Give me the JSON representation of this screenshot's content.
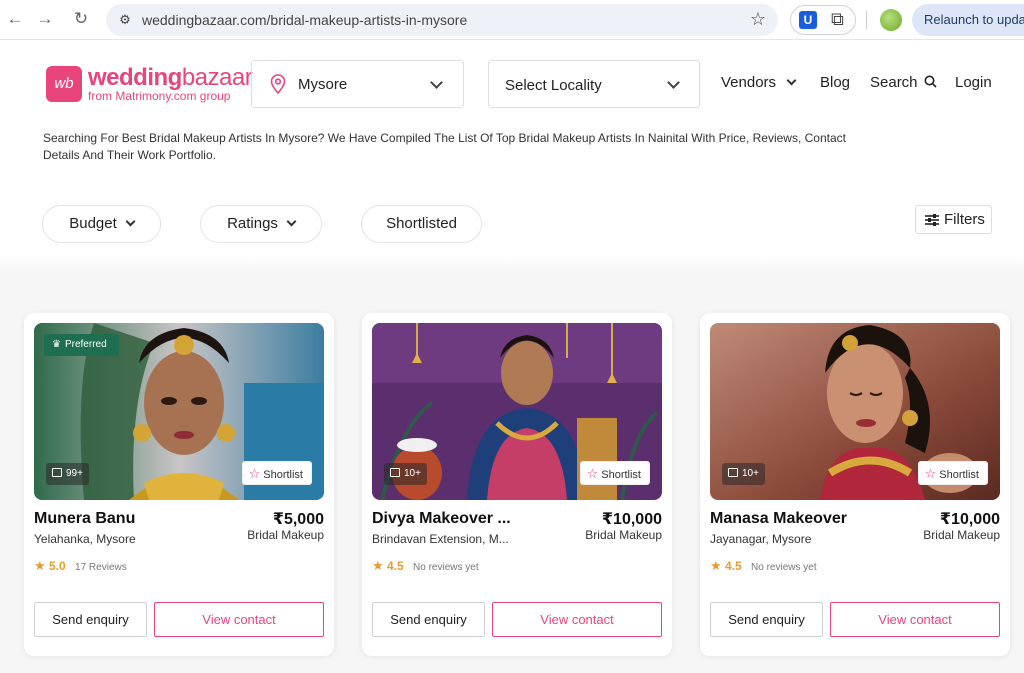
{
  "browser": {
    "url": "weddingbazaar.com/bridal-makeup-artists-in-mysore",
    "relaunch_label": "Relaunch to update"
  },
  "site": {
    "logo_word_1": "wedding",
    "logo_word_2": "bazaar",
    "logo_mark": "wb",
    "logo_sub": "from Matrimony.com group",
    "city": "Mysore",
    "locality_placeholder": "Select Locality",
    "nav": {
      "vendors": "Vendors",
      "blog": "Blog",
      "search": "Search",
      "login": "Login"
    },
    "intro": "Searching For Best Bridal Makeup Artists In Mysore? We Have Compiled The List Of Top Bridal Makeup Artists In Nainital With Price, Reviews, Contact Details And Their Work Portfolio."
  },
  "filters": {
    "budget": "Budget",
    "ratings": "Ratings",
    "shortlisted": "Shortlisted",
    "filters_button": "Filters"
  },
  "colors": {
    "brand_pink": "#e8457d",
    "preferred_green": "#1f6e52",
    "rating_orange": "#e89b2a"
  },
  "cards": [
    {
      "name": "Munera Banu",
      "location": "Yelahanka, Mysore",
      "price": "₹5,000",
      "category": "Bridal Makeup",
      "rating": "5.0",
      "reviews": "17 Reviews",
      "photo_count": "99+",
      "preferred": "Preferred",
      "shortlist": "Shortlist",
      "enquiry": "Send enquiry",
      "contact": "View contact"
    },
    {
      "name": "Divya Makeover ...",
      "location": "Brindavan Extension, M...",
      "price": "₹10,000",
      "category": "Bridal Makeup",
      "rating": "4.5",
      "reviews": "No reviews yet",
      "photo_count": "10+",
      "shortlist": "Shortlist",
      "enquiry": "Send enquiry",
      "contact": "View contact"
    },
    {
      "name": "Manasa Makeover",
      "location": "Jayanagar, Mysore",
      "price": "₹10,000",
      "category": "Bridal Makeup",
      "rating": "4.5",
      "reviews": "No reviews yet",
      "photo_count": "10+",
      "shortlist": "Shortlist",
      "enquiry": "Send enquiry",
      "contact": "View contact"
    }
  ]
}
